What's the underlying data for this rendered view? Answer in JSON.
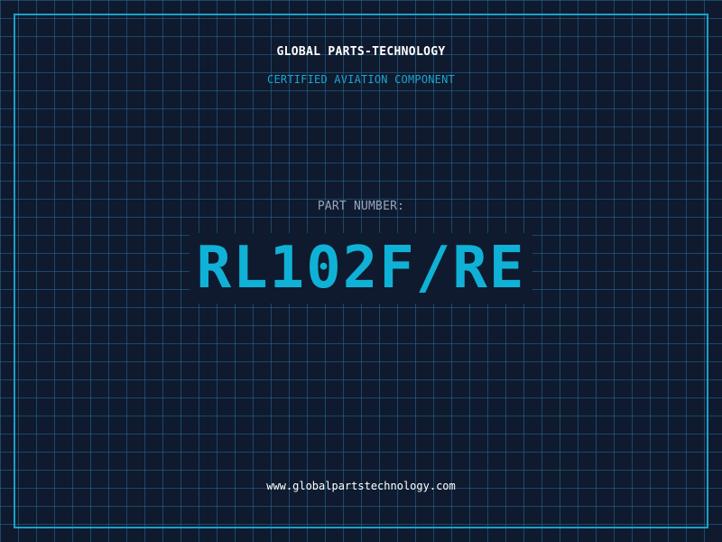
{
  "header": {
    "title": "GLOBAL PARTS-TECHNOLOGY",
    "subtitle": "CERTIFIED AVIATION COMPONENT"
  },
  "part": {
    "label": "PART NUMBER:",
    "number": "RL102F/RE"
  },
  "footer": {
    "url": "www.globalpartstechnology.com"
  },
  "colors": {
    "background": "#0f1a2e",
    "grid": "#246e96",
    "accent": "#1aa0c8",
    "part_number": "#0fb2d6"
  }
}
